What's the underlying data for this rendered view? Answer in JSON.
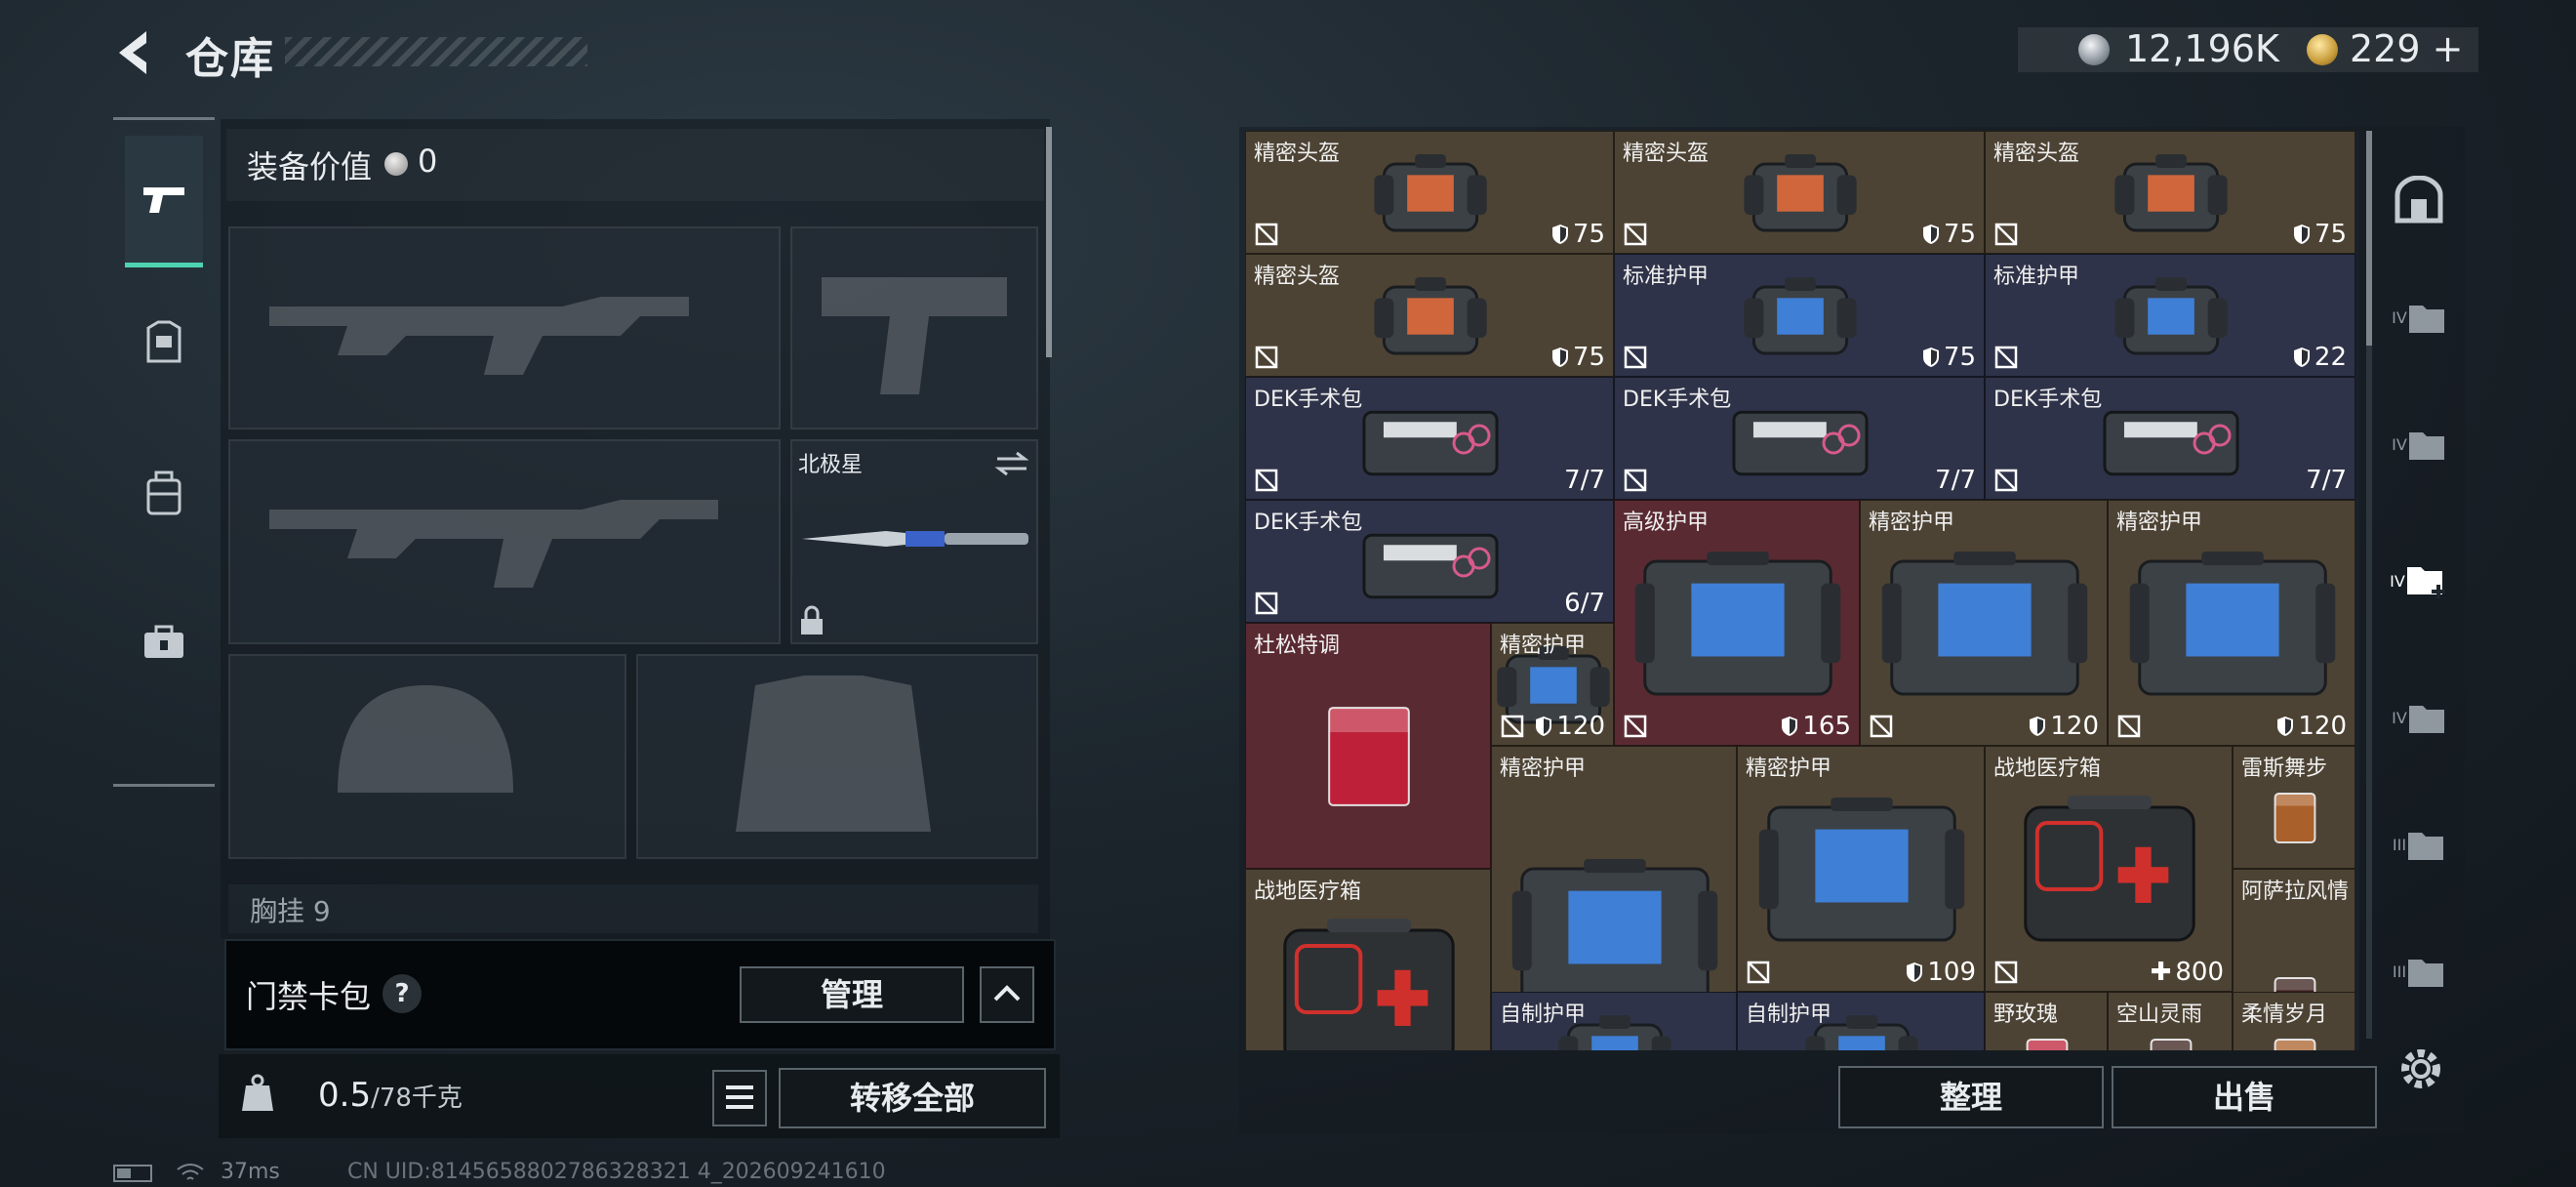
{
  "header": {
    "title": "仓库",
    "currency": [
      {
        "icon": "silver-coin-icon",
        "value": "12,196K"
      },
      {
        "icon": "gold-coin-icon",
        "value": "229"
      }
    ]
  },
  "nav": [
    {
      "name": "pistol-icon",
      "active": true
    },
    {
      "name": "armor-icon",
      "active": false
    },
    {
      "name": "backpack-icon",
      "active": false
    },
    {
      "name": "medkit-case-icon",
      "active": false
    }
  ],
  "loadout": {
    "equip_label": "装备价值",
    "equip_value": "0",
    "melee_name": "北极星",
    "chest_label": "胸挂",
    "chest_extra": "9",
    "card_label": "门禁卡包",
    "card_help": "?",
    "manage_label": "管理",
    "weight_value": "0.5",
    "weight_unit": "/78千克",
    "transfer_label": "转移全部"
  },
  "storage": {
    "items": [
      {
        "name": "精密头盔",
        "value": "75",
        "kind": "helmet",
        "bg": "brown",
        "icon": "shield-icon"
      },
      {
        "name": "精密头盔",
        "value": "75",
        "kind": "helmet",
        "bg": "brown",
        "icon": "shield-icon"
      },
      {
        "name": "精密头盔",
        "value": "75",
        "kind": "helmet",
        "bg": "brown",
        "icon": "shield-icon"
      },
      {
        "name": "精密头盔",
        "value": "75",
        "kind": "helmet",
        "bg": "brown",
        "icon": "shield-icon"
      },
      {
        "name": "标准护甲",
        "value": "75",
        "kind": "vest",
        "bg": "blue",
        "icon": "shield-icon"
      },
      {
        "name": "标准护甲",
        "value": "22",
        "kind": "vest",
        "bg": "blue",
        "icon": "shield-icon"
      },
      {
        "name": "DEK手术包",
        "value": "7/7",
        "kind": "kit",
        "bg": "blue",
        "icon": ""
      },
      {
        "name": "DEK手术包",
        "value": "7/7",
        "kind": "kit",
        "bg": "blue",
        "icon": ""
      },
      {
        "name": "DEK手术包",
        "value": "7/7",
        "kind": "kit",
        "bg": "blue",
        "icon": ""
      },
      {
        "name": "DEK手术包",
        "value": "6/7",
        "kind": "kit",
        "bg": "blue",
        "icon": ""
      },
      {
        "name": "高级护甲",
        "value": "165",
        "kind": "vest-big",
        "bg": "red",
        "icon": "shield-icon"
      },
      {
        "name": "精密护甲",
        "value": "120",
        "kind": "vest-big",
        "bg": "brown",
        "icon": "shield-icon"
      },
      {
        "name": "精密护甲",
        "value": "120",
        "kind": "vest-big",
        "bg": "brown",
        "icon": "shield-icon"
      },
      {
        "name": "精密护甲",
        "value": "120",
        "kind": "vest-big",
        "bg": "brown",
        "icon": "shield-icon"
      },
      {
        "name": "杜松特调",
        "value": "",
        "kind": "drink-red",
        "bg": "red",
        "icon": ""
      },
      {
        "name": "精密护甲",
        "value": "120",
        "kind": "vest-big",
        "bg": "brown",
        "icon": "shield-icon"
      },
      {
        "name": "精密护甲",
        "value": "109",
        "kind": "vest-big",
        "bg": "brown",
        "icon": "shield-icon"
      },
      {
        "name": "战地医疗箱",
        "value": "800",
        "kind": "medbox",
        "bg": "brown",
        "icon": "plus-icon"
      },
      {
        "name": "雷斯舞步",
        "value": "",
        "kind": "drink-amber",
        "bg": "brown",
        "icon": ""
      },
      {
        "name": "战地医疗箱",
        "value": "",
        "kind": "medbox",
        "bg": "brown",
        "icon": ""
      },
      {
        "name": "阿萨拉风情",
        "value": "",
        "kind": "drink-dark",
        "bg": "brown",
        "icon": ""
      },
      {
        "name": "自制护甲",
        "value": "",
        "kind": "vest",
        "bg": "blue",
        "icon": ""
      },
      {
        "name": "自制护甲",
        "value": "",
        "kind": "vest",
        "bg": "blue",
        "icon": ""
      },
      {
        "name": "野玫瑰",
        "value": "",
        "kind": "drink-red",
        "bg": "brown",
        "icon": ""
      },
      {
        "name": "空山灵雨",
        "value": "",
        "kind": "drink-dark",
        "bg": "brown",
        "icon": ""
      },
      {
        "name": "柔情岁月",
        "value": "",
        "kind": "drink-amber",
        "bg": "brown",
        "icon": ""
      }
    ],
    "sort_label": "整理",
    "sell_label": "出售"
  },
  "tiers": [
    "",
    "IV",
    "IV",
    "IV",
    "IV",
    "III",
    "III"
  ],
  "footer": {
    "ping": "37ms",
    "uid": "CN UID:8145658802786328321 4_202609241610"
  }
}
